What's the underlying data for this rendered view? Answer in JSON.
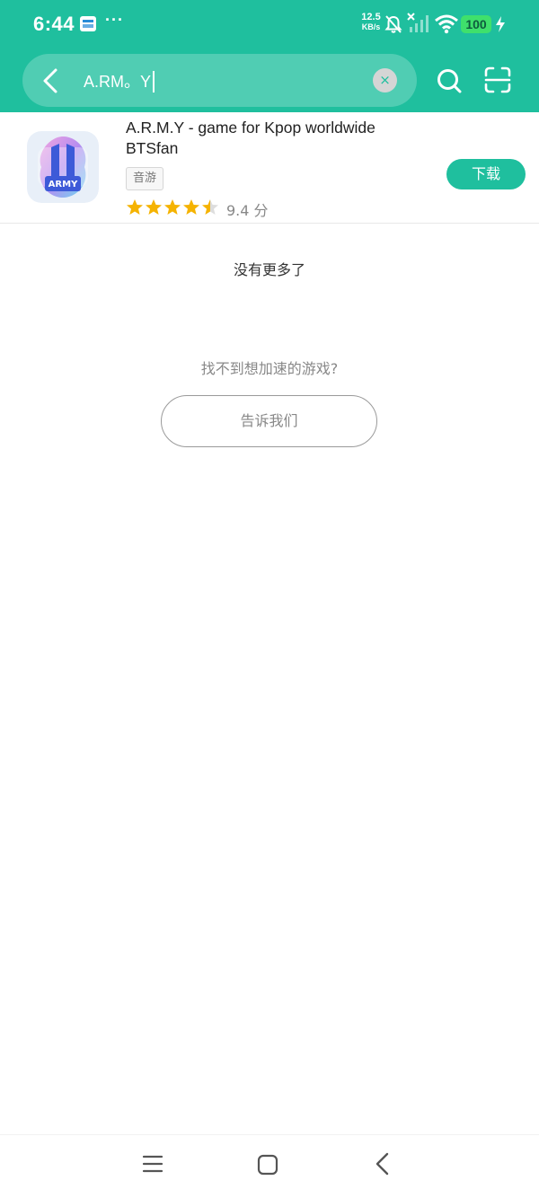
{
  "status_bar": {
    "time": "6:44",
    "more": "···",
    "net_speed_value": "12.5",
    "net_speed_unit": "KB/s",
    "battery": "100",
    "icons": [
      "calendar-notification-icon",
      "mute-icon",
      "signal-icon",
      "wifi-icon",
      "battery-icon",
      "charging-icon"
    ]
  },
  "search": {
    "query": "A.RM。Y",
    "clear_icon": "×"
  },
  "result": {
    "title": "A.R.M.Y - game for Kpop worldwide BTSfan",
    "tag": "音游",
    "rating_stars": 4.5,
    "score": "9.4 分",
    "download_label": "下载",
    "icon_text": "ARMY"
  },
  "messages": {
    "no_more": "没有更多了",
    "not_found": "找不到想加速的游戏?",
    "tell_us": "告诉我们"
  },
  "colors": {
    "brand": "#1fbf9e",
    "star": "#f5b301"
  }
}
